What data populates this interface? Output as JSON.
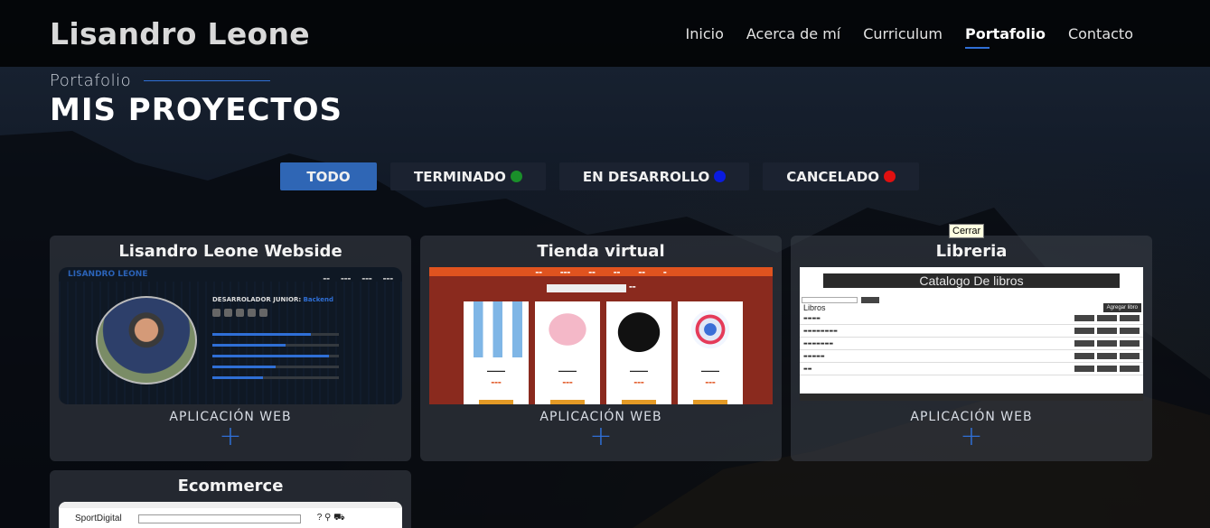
{
  "brand": "Lisandro Leone",
  "nav": [
    {
      "label": "Inicio"
    },
    {
      "label": "Acerca de mí"
    },
    {
      "label": "Curriculum"
    },
    {
      "label": "Portafolio",
      "active": true
    },
    {
      "label": "Contacto"
    }
  ],
  "section": {
    "kicker": "Portafolio",
    "title": "MIS PROYECTOS"
  },
  "filters": [
    {
      "label": "TODO",
      "active": true
    },
    {
      "label": "TERMINADO",
      "dot": "#1a8f2a"
    },
    {
      "label": "EN DESARROLLO",
      "dot": "#0a1be0"
    },
    {
      "label": "CANCELADO",
      "dot": "#e01010"
    }
  ],
  "tooltip": "Cerrar",
  "cards": [
    {
      "title": "Lisandro Leone Webside",
      "category": "APLICACIÓN WEB"
    },
    {
      "title": "Tienda virtual",
      "category": "APLICACIÓN WEB"
    },
    {
      "title": "Libreria",
      "category": "APLICACIÓN WEB"
    },
    {
      "title": "Ecommerce"
    }
  ],
  "thumb_texts": {
    "t1_logo": "LISANDRO LEONE",
    "t1_role": "DESARROLADOR JUNIOR: ",
    "t1_role_accent": "Backend",
    "t3_header": "Catalogo De libros",
    "t3_list_title": "Libros",
    "t3_add": "Agregar libro",
    "t4_brand": "SportDigital"
  },
  "colors": {
    "accent": "#2f6fd6",
    "filter_active": "#2f66b5"
  }
}
